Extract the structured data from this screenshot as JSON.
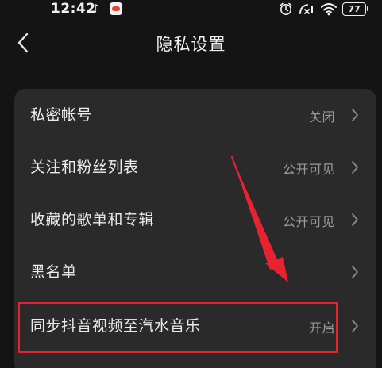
{
  "status_bar": {
    "time": "12:42",
    "note_glyph": "♪",
    "battery": "77"
  },
  "header": {
    "title": "隐私设置"
  },
  "settings": [
    {
      "label": "私密帐号",
      "value": "关闭"
    },
    {
      "label": "关注和粉丝列表",
      "value": "公开可见"
    },
    {
      "label": "收藏的歌单和专辑",
      "value": "公开可见"
    },
    {
      "label": "黑名单",
      "value": ""
    },
    {
      "label": "同步抖音视频至汽水音乐",
      "value": "开启"
    }
  ],
  "colors": {
    "background": "#141414",
    "card": "#2a2a2a",
    "annotation": "#e8232f",
    "secondary_text": "#9a9a9a"
  },
  "icons": {
    "back": "chevron-left-icon",
    "row_chevron": "chevron-right-icon",
    "alarm": "alarm-icon",
    "signal": "signal-off-icon",
    "wifi": "wifi-icon"
  }
}
